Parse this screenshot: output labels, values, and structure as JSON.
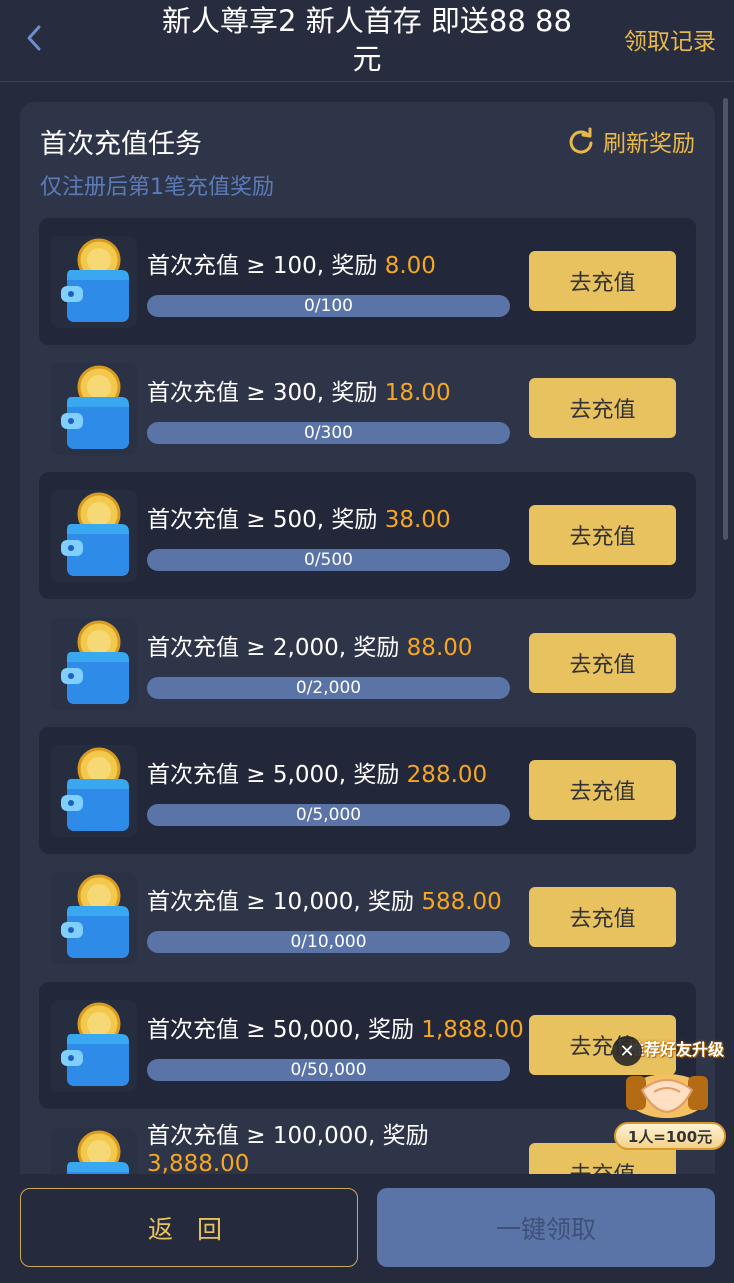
{
  "header": {
    "title": "新人尊享2 新人首存 即送88 88元",
    "history_label": "领取记录"
  },
  "card": {
    "title": "首次充值任务",
    "subtitle": "仅注册后第1笔充值奖励",
    "refresh_label": "刷新奖励"
  },
  "tasks": [
    {
      "condition": "首次充值 ≥ 100, 奖励 ",
      "reward": "8.00",
      "progress": "0/100",
      "progress_value": 0,
      "button": "去充值"
    },
    {
      "condition": "首次充值 ≥ 300, 奖励 ",
      "reward": "18.00",
      "progress": "0/300",
      "progress_value": 0,
      "button": "去充值"
    },
    {
      "condition": "首次充值 ≥ 500, 奖励 ",
      "reward": "38.00",
      "progress": "0/500",
      "progress_value": 0,
      "button": "去充值"
    },
    {
      "condition": "首次充值 ≥ 2,000, 奖励 ",
      "reward": "88.00",
      "progress": "0/2,000",
      "progress_value": 0,
      "button": "去充值"
    },
    {
      "condition": "首次充值 ≥ 5,000, 奖励 ",
      "reward": "288.00",
      "progress": "0/5,000",
      "progress_value": 0,
      "button": "去充值"
    },
    {
      "condition": "首次充值 ≥ 10,000, 奖励 ",
      "reward": "588.00",
      "progress": "0/10,000",
      "progress_value": 0,
      "button": "去充值"
    },
    {
      "condition": "首次充值 ≥ 50,000, 奖励 ",
      "reward": "1,888.00",
      "progress": "0/50,000",
      "progress_value": 0,
      "button": "去充值"
    },
    {
      "condition": "首次充值 ≥ 100,000, 奖励 ",
      "reward": "3,888.00",
      "progress": "",
      "progress_value": 0,
      "button": "去充值"
    }
  ],
  "footer": {
    "return_label": "返 回",
    "claim_label": "一键领取"
  },
  "promo": {
    "title": "推荐好友升级",
    "tag": "1人=100元"
  },
  "colors": {
    "accent_gold": "#e8c25e",
    "reward_orange": "#f5a623",
    "subtitle_blue": "#5a7bb8",
    "progress_blue": "#5a74a8",
    "background": "#252b3c",
    "card": "#2f3549"
  }
}
